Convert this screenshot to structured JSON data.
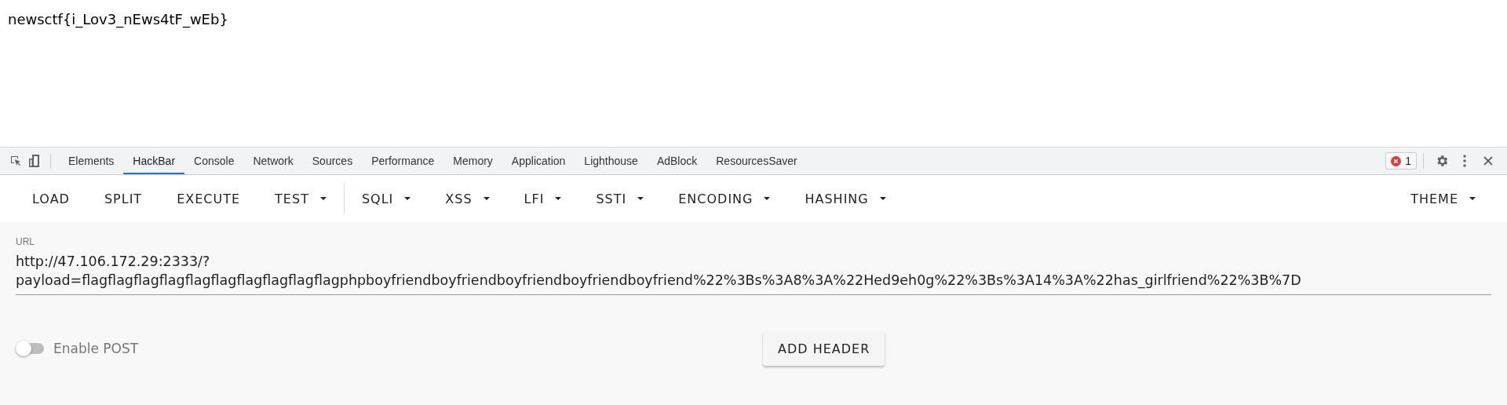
{
  "page": {
    "text": "newsctf{i_Lov3_nEws4tF_wEb}"
  },
  "devtools": {
    "tabs": [
      {
        "label": "Elements",
        "selected": false
      },
      {
        "label": "HackBar",
        "selected": true
      },
      {
        "label": "Console",
        "selected": false
      },
      {
        "label": "Network",
        "selected": false
      },
      {
        "label": "Sources",
        "selected": false
      },
      {
        "label": "Performance",
        "selected": false
      },
      {
        "label": "Memory",
        "selected": false
      },
      {
        "label": "Application",
        "selected": false
      },
      {
        "label": "Lighthouse",
        "selected": false
      },
      {
        "label": "AdBlock",
        "selected": false
      },
      {
        "label": "ResourcesSaver",
        "selected": false
      }
    ],
    "error_count": "1"
  },
  "hackbar": {
    "menu": [
      {
        "label": "LOAD",
        "dropdown": false
      },
      {
        "label": "SPLIT",
        "dropdown": false
      },
      {
        "label": "EXECUTE",
        "dropdown": false
      },
      {
        "label": "TEST",
        "dropdown": true
      },
      {
        "label": "SQLI",
        "dropdown": true
      },
      {
        "label": "XSS",
        "dropdown": true
      },
      {
        "label": "LFI",
        "dropdown": true
      },
      {
        "label": "SSTI",
        "dropdown": true
      },
      {
        "label": "ENCODING",
        "dropdown": true
      },
      {
        "label": "HASHING",
        "dropdown": true
      }
    ],
    "theme": {
      "label": "THEME",
      "dropdown": true
    },
    "url": {
      "label": "URL",
      "value": "http://47.106.172.29:2333/?payload=flagflagflagflagflagflagflagflagflagflagphpboyfriendboyfriendboyfriendboyfriendboyfriend%22%3Bs%3A8%3A%22Hed9eh0g%22%3Bs%3A14%3A%22has_girlfriend%22%3B%7D"
    },
    "enable_post": {
      "label": "Enable POST",
      "on": false
    },
    "add_header": "ADD HEADER"
  }
}
